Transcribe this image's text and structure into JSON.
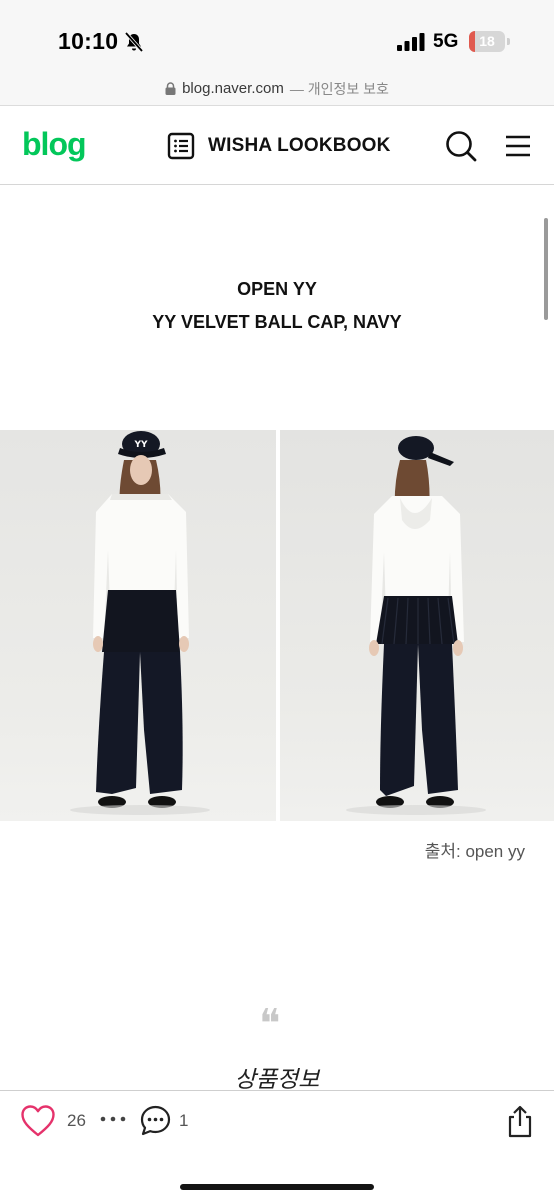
{
  "status_bar": {
    "time": "10:10",
    "network": "5G",
    "battery_level": "18",
    "battery_fraction": 0.18,
    "icons": [
      "bell-slash-icon",
      "signal-bars-icon",
      "battery-icon"
    ]
  },
  "url_bar": {
    "host": "blog.naver.com",
    "note": "— 개인정보 보호"
  },
  "blog_header": {
    "logo": "blog",
    "title": "WISHA LOOKBOOK",
    "icons": [
      "list-icon",
      "search-icon",
      "menu-icon"
    ]
  },
  "post": {
    "brand": "OPEN YY",
    "product": "YY VELVET BALL CAP, NAVY",
    "photo_caption": "출처: open yy",
    "quote_mark": "❝",
    "section_title": "상품정보"
  },
  "actions": {
    "like_count": "26",
    "comment_count": "1",
    "icons": [
      "heart-icon",
      "more-dots-icon",
      "comment-icon",
      "share-icon"
    ]
  },
  "colors": {
    "brand_green": "#03c75a",
    "heart_pink": "#e5326b",
    "battery_red": "#e05a4f"
  }
}
